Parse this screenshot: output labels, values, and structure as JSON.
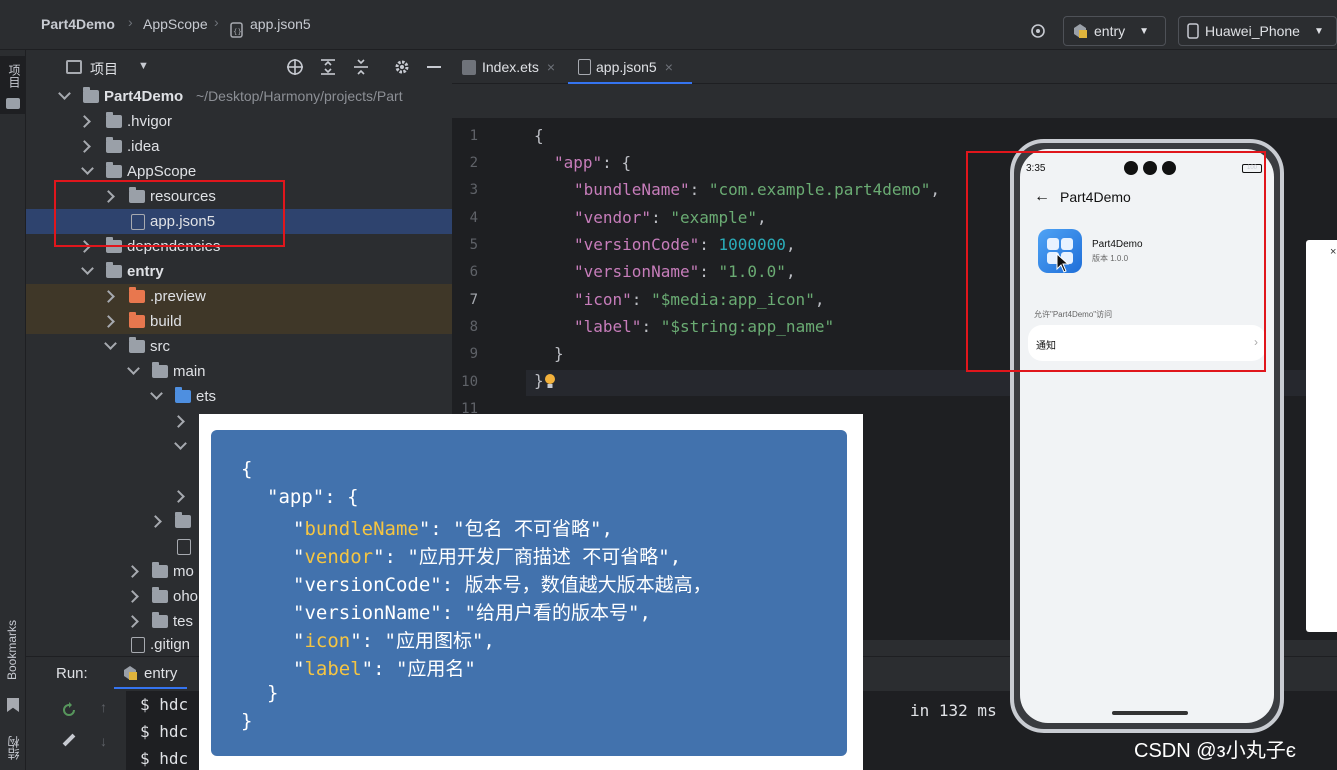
{
  "breadcrumbs": [
    "Part4Demo",
    "AppScope",
    "app.json5"
  ],
  "toolbar": {
    "run_config": "entry",
    "device": "Huawei_Phone"
  },
  "left_stripe": {
    "project": "项目",
    "bookmarks": "Bookmarks",
    "structure": "结构"
  },
  "project_panel": {
    "title": "项目",
    "tree": [
      {
        "label": "Part4Demo",
        "hint": "~/Desktop/Harmony/projects/Part"
      },
      {
        "label": ".hvigor"
      },
      {
        "label": ".idea"
      },
      {
        "label": "AppScope"
      },
      {
        "label": "resources"
      },
      {
        "label": "app.json5"
      },
      {
        "label": "dependencies"
      },
      {
        "label": "entry"
      },
      {
        "label": ".preview"
      },
      {
        "label": "build"
      },
      {
        "label": "src"
      },
      {
        "label": "main"
      },
      {
        "label": "ets"
      },
      {
        "label": "mo"
      },
      {
        "label": "oho"
      },
      {
        "label": "tes"
      },
      {
        "label": ".gitign"
      }
    ]
  },
  "editor": {
    "tabs": [
      "Index.ets",
      "app.json5"
    ],
    "line_numbers": [
      "1",
      "2",
      "3",
      "4",
      "5",
      "6",
      "7",
      "8",
      "9",
      "10",
      "11"
    ],
    "code": {
      "open": "{",
      "app_key": "\"app\"",
      "bundle_key": "\"bundleName\"",
      "bundle_val": "\"com.example.part4demo\"",
      "vendor_key": "\"vendor\"",
      "vendor_val": "\"example\"",
      "vcode_key": "\"versionCode\"",
      "vcode_val": "1000000",
      "vname_key": "\"versionName\"",
      "vname_val": "\"1.0.0\"",
      "icon_key": "\"icon\"",
      "icon_val": "\"$media:app_icon\"",
      "label_key": "\"label\"",
      "label_val": "\"$string:app_name\"",
      "inner_close": "}",
      "close": "}"
    }
  },
  "run_panel": {
    "label": "Run:",
    "tab": "entry",
    "lines": [
      "$ hdc",
      "$ hdc",
      "$ hdc"
    ],
    "tail": "in 132 ms"
  },
  "overlay": {
    "line1": "{",
    "line2_pre": "\"app\": {",
    "bundle_key": "bundleName",
    "bundle_desc": "\"包名 不可省略\",",
    "vendor_key": "vendor",
    "vendor_desc": "\"应用开发厂商描述 不可省略\",",
    "vcode_line": "\"versionCode\": 版本号，数值越大版本越高，",
    "vname_line": "\"versionName\": \"给用户看的版本号\",",
    "icon_key": "icon",
    "icon_desc": "\"应用图标\",",
    "label_key": "label",
    "label_desc": "\"应用名\"",
    "inner_close": "}",
    "close": "}"
  },
  "phone": {
    "time": "3:35",
    "battery": "100",
    "page_title": "Part4Demo",
    "app_name": "Part4Demo",
    "version": "版本 1.0.0",
    "allow_text": "允许\"Part4Demo\"访问",
    "notify": "通知"
  },
  "watermark": "CSDN @з小丸子є",
  "colors": {
    "accent": "#3574f0",
    "highlight_box": "#e0161c",
    "overlay_bg": "#4272ad",
    "overlay_key": "#f5c542"
  }
}
